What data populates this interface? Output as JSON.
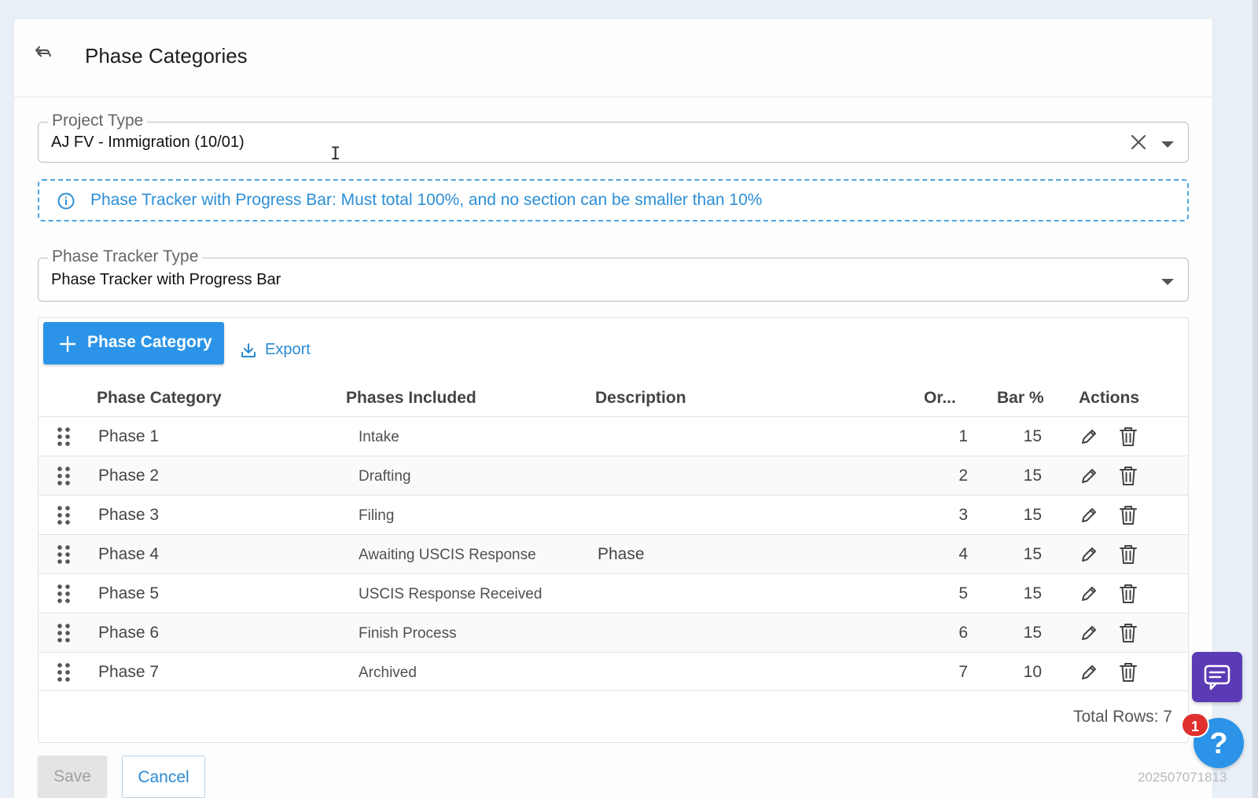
{
  "header": {
    "title": "Phase Categories",
    "back_icon": "back-arrow-icon"
  },
  "project_type": {
    "label": "Project Type",
    "value": "AJ FV - Immigration (10/01)"
  },
  "info": {
    "text": "Phase Tracker with Progress Bar: Must total 100%, and no section can be smaller than 10%",
    "color": "#2c8fd6"
  },
  "tracker_type": {
    "label": "Phase Tracker Type",
    "value": "Phase Tracker with Progress Bar"
  },
  "toolbar": {
    "add_label": "Phase Category",
    "export_label": "Export"
  },
  "table": {
    "columns": {
      "category": "Phase Category",
      "phases": "Phases Included",
      "description": "Description",
      "order": "Or...",
      "bar": "Bar %",
      "actions": "Actions"
    },
    "rows": [
      {
        "category": "Phase 1",
        "phases": "Intake",
        "description": "",
        "order": "1",
        "bar": "15"
      },
      {
        "category": "Phase 2",
        "phases": "Drafting",
        "description": "",
        "order": "2",
        "bar": "15"
      },
      {
        "category": "Phase 3",
        "phases": "Filing",
        "description": "",
        "order": "3",
        "bar": "15"
      },
      {
        "category": "Phase 4",
        "phases": "Awaiting USCIS Response",
        "description": "Phase",
        "order": "4",
        "bar": "15"
      },
      {
        "category": "Phase 5",
        "phases": "USCIS Response Received",
        "description": "",
        "order": "5",
        "bar": "15"
      },
      {
        "category": "Phase 6",
        "phases": "Finish Process",
        "description": "",
        "order": "6",
        "bar": "15"
      },
      {
        "category": "Phase 7",
        "phases": "Archived",
        "description": "",
        "order": "7",
        "bar": "10"
      }
    ],
    "total_rows": "Total Rows: 7"
  },
  "footer": {
    "save_label": "Save",
    "cancel_label": "Cancel",
    "version": "202507071813"
  },
  "widgets": {
    "badge_count": "1",
    "accent": "#2b94e8",
    "chat_color": "#5b3bb5"
  }
}
